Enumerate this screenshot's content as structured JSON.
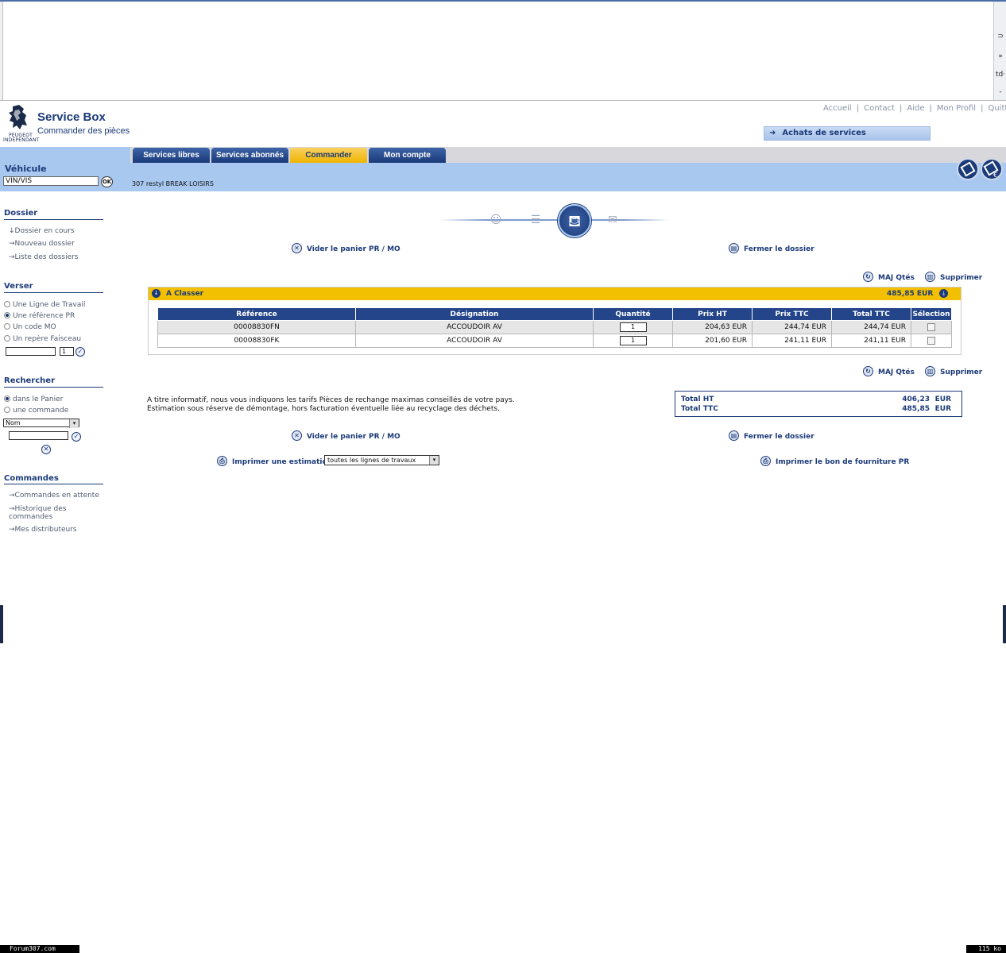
{
  "browser": {
    "side_glyphs": [
      "⊃",
      "»",
      "td·",
      "-"
    ]
  },
  "header": {
    "logo_brand": "PEUGEOT",
    "logo_tag": "INDEPENDANT",
    "title": "Service Box",
    "subtitle": "Commander des pièces",
    "top_links": [
      "Accueil",
      "Contact",
      "Aide",
      "Mon Profil",
      "Quitter"
    ],
    "achats_label": "Achats de services"
  },
  "tabs": [
    {
      "label": "Services libres",
      "active": false
    },
    {
      "label": "Services abonnés",
      "active": false
    },
    {
      "label": "Commander",
      "active": true
    },
    {
      "label": "Mon compte",
      "active": false
    }
  ],
  "vehicle": {
    "title": "Véhicule",
    "vin_value": "VIN/VIS",
    "ok_label": "OK",
    "model": "307 restyl BREAK LOISIRS"
  },
  "sidebar": {
    "dossier": {
      "title": "Dossier",
      "links": [
        "Dossier en cours",
        "Nouveau dossier",
        "Liste des dossiers"
      ]
    },
    "verser": {
      "title": "Verser",
      "options": [
        "Une Ligne de Travail",
        "Une référence PR",
        "Un code MO",
        "Un repère Faisceau"
      ],
      "selected": "Une référence PR",
      "qty_value": "1"
    },
    "rechercher": {
      "title": "Rechercher",
      "options": [
        "dans le Panier",
        "une commande"
      ],
      "selected": "dans le Panier",
      "select_value": "Nom"
    },
    "commandes": {
      "title": "Commandes",
      "links": [
        "Commandes en attente",
        "Historique des commandes",
        "Mes distributeurs"
      ]
    }
  },
  "actions": {
    "vider": "Vider le panier PR / MO",
    "fermer": "Fermer le dossier",
    "maj": "MAJ Qtés",
    "supprimer": "Supprimer",
    "imprimer_estimation": "Imprimer une estimation",
    "imprimer_bon": "Imprimer le bon de fourniture PR",
    "estimation_option": "toutes les lignes de travaux"
  },
  "basket": {
    "title": "A Classer",
    "total": "485,85 EUR",
    "columns": [
      "Référence",
      "Désignation",
      "Quantité",
      "Prix HT",
      "Prix TTC",
      "Total TTC",
      "Sélection"
    ],
    "rows": [
      {
        "ref": "00008830FN",
        "designation": "ACCOUDOIR AV",
        "qty": "1",
        "prix_ht": "204,63 EUR",
        "prix_ttc": "244,74 EUR",
        "total_ttc": "244,74 EUR"
      },
      {
        "ref": "00008830FK",
        "designation": "ACCOUDOIR AV",
        "qty": "1",
        "prix_ht": "201,60 EUR",
        "prix_ttc": "241,11 EUR",
        "total_ttc": "241,11 EUR"
      }
    ]
  },
  "info": {
    "line1": "A titre informatif, nous vous indiquons les tarifs Pièces de rechange maximas conseillés de votre pays.",
    "line2": "Estimation sous réserve de démontage, hors facturation éventuelle liée au recyclage des déchets."
  },
  "totals": {
    "ht_label": "Total HT",
    "ht_value": "406,23",
    "ttc_label": "Total TTC",
    "ttc_value": "485,85",
    "currency": "EUR"
  },
  "footer": {
    "left": "Forum307.com",
    "right": "115 ko"
  },
  "colors": {
    "navy": "#1b3a78",
    "tab_active": "#f0b400",
    "band": "#a8c8f0",
    "basket_head": "#f2c000"
  }
}
